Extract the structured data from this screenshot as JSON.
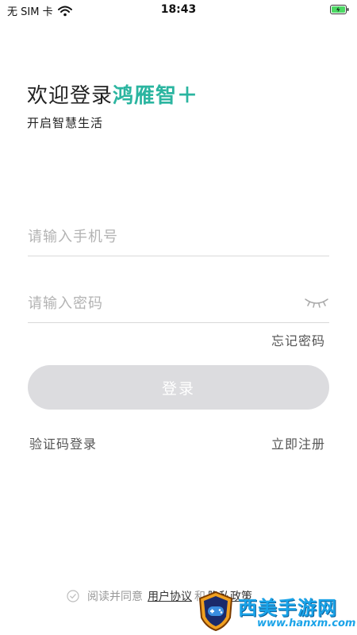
{
  "status_bar": {
    "carrier": "无 SIM 卡",
    "time": "18:43"
  },
  "header": {
    "welcome_prefix": "欢迎登录",
    "brand": "鸿雁智＋",
    "subtitle": "开启智慧生活"
  },
  "form": {
    "phone_placeholder": "请输入手机号",
    "password_placeholder": "请输入密码",
    "forgot_password": "忘记密码",
    "login_button": "登录",
    "sms_login": "验证码登录",
    "register": "立即注册"
  },
  "agreement": {
    "prefix": "阅读并同意",
    "user_agreement": "用户协议",
    "connector": "和",
    "privacy_policy": "隐私政策"
  },
  "watermark": {
    "name": "西美手游网",
    "url": "www.hanxm.com"
  },
  "colors": {
    "brand": "#2bb5a0",
    "button_disabled": "#dcdcdf",
    "battery": "#4cd964"
  },
  "icons": {
    "wifi": "wifi-icon",
    "battery": "battery-charging-icon",
    "eye": "eye-closed-icon",
    "check": "check-circle-icon"
  }
}
